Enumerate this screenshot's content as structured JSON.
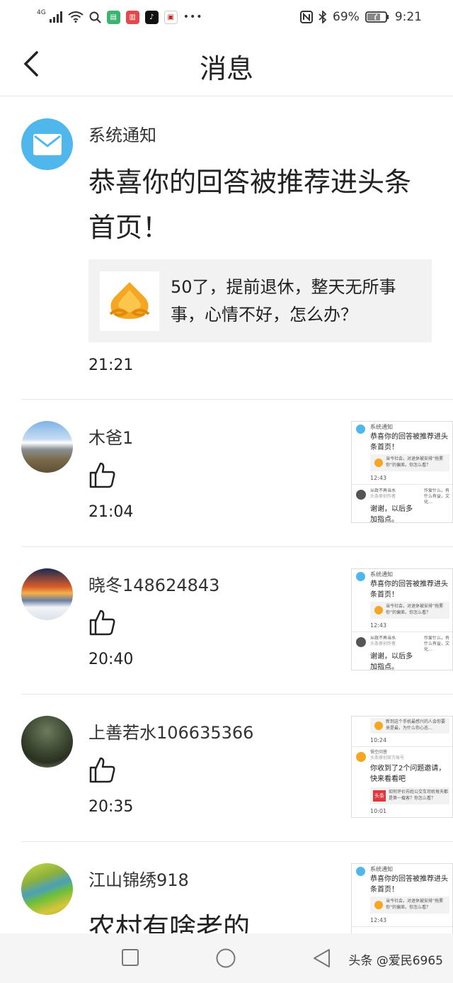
{
  "status": {
    "network": "4G",
    "battery": "69%",
    "time": "9:21"
  },
  "header": {
    "title": "消息"
  },
  "system_notice": {
    "label": "系统通知",
    "message": "恭喜你的回答被推荐进头条首页！",
    "quote": "50了，提前退休，整天无所事事，心情不好，怎么办？",
    "time": "21:21"
  },
  "thumb_card": {
    "label": "系统通知",
    "message": "恭喜你的回答被推荐进头条首页！",
    "quote": "当今社会，对退休被安排“拖累你”的偏差。你怎么看？",
    "time": "12:43",
    "reply_name": "从政不再当水",
    "reply_meta": "头条原创作者",
    "reply_side": "作爱什么，有什么有益，文化…",
    "reply_text": "谢谢，以后多加指点。"
  },
  "thumb_card_alt": {
    "top": "新到这个手机最感兴的人会你要来是最，为什么你心态…",
    "name": "悟空问答",
    "meta": "头条原创官方账号",
    "invite": "你收到了2个问题邀请，快来看看吧",
    "tag": "头条",
    "question": "如何评价苏姓公交车司机每天都是第一载客？你怎么看？",
    "time_top": "10:24",
    "time_bottom": "10:01"
  },
  "messages": [
    {
      "name": "木爸1",
      "time": "21:04"
    },
    {
      "name": "晓冬148624843",
      "time": "20:40"
    },
    {
      "name": "上善若水106635366",
      "time": "20:35"
    },
    {
      "name": "江山锦绣918",
      "partial": "农村有啥老的"
    }
  ],
  "footer": {
    "watermark": "头条 @爱民6965"
  },
  "colors": {
    "mail_icon_bg": "#4fb7ec",
    "accent_flame": "#f5a623"
  }
}
